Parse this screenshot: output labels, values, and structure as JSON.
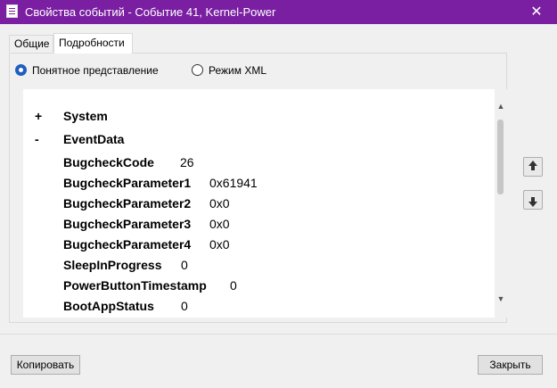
{
  "window": {
    "title": "Свойства событий - Событие 41, Kernel-Power",
    "close_glyph": "✕",
    "accent_color": "#7a1fa2"
  },
  "tabs": [
    {
      "label": "Общие",
      "selected": false
    },
    {
      "label": "Подробности",
      "selected": true
    }
  ],
  "view_mode": {
    "options": [
      {
        "label": "Понятное представление",
        "checked": true
      },
      {
        "label": "Режим XML",
        "checked": false
      }
    ]
  },
  "tree": {
    "system": {
      "toggle": "+",
      "label": "System"
    },
    "eventdata": {
      "toggle": "-",
      "label": "EventData"
    },
    "fields": [
      {
        "name": "BugcheckCode",
        "value": "26"
      },
      {
        "name": "BugcheckParameter1",
        "value": "0x61941"
      },
      {
        "name": "BugcheckParameter2",
        "value": "0x0"
      },
      {
        "name": "BugcheckParameter3",
        "value": "0x0"
      },
      {
        "name": "BugcheckParameter4",
        "value": "0x0"
      },
      {
        "name": "SleepInProgress",
        "value": "0"
      },
      {
        "name": "PowerButtonTimestamp",
        "value": "0"
      },
      {
        "name": "BootAppStatus",
        "value": "0"
      }
    ]
  },
  "icons": {
    "scroll_up": "up-chevron-icon",
    "scroll_down": "down-chevron-icon",
    "nav_up": "arrow-up-icon",
    "nav_down": "arrow-down-icon"
  },
  "buttons": {
    "copy": "Копировать",
    "close": "Закрыть"
  }
}
